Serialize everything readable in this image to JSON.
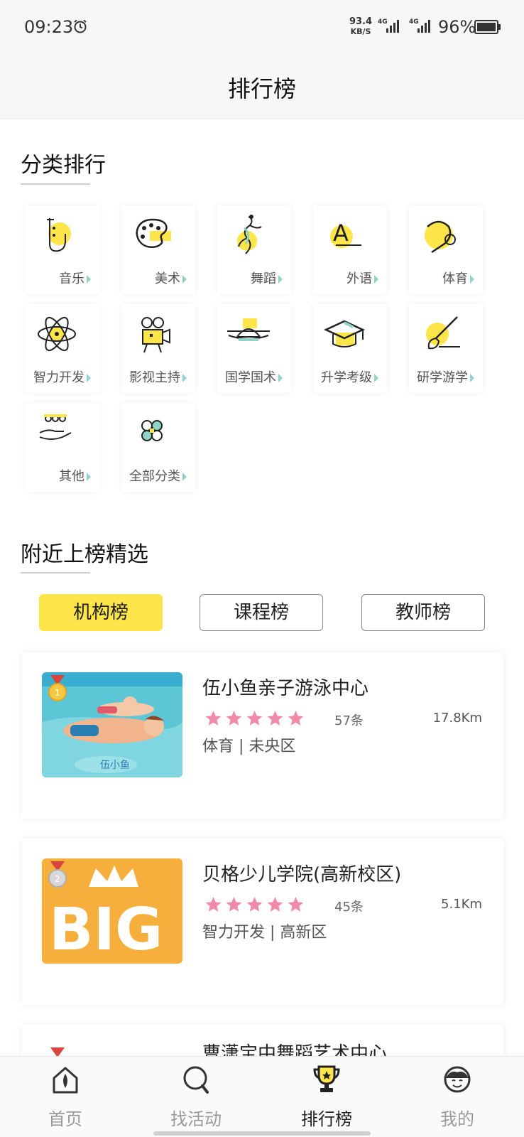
{
  "status_bar": {
    "time": "09:23",
    "net_speed": "93.4",
    "net_unit": "KB/S",
    "network_1": "4G",
    "network_2": "4G",
    "battery": "96%"
  },
  "header": {
    "title": "排行榜"
  },
  "categories_section": {
    "title": "分类排行",
    "items": [
      {
        "label": "音乐",
        "icon": "saxophone-icon"
      },
      {
        "label": "美术",
        "icon": "palette-icon"
      },
      {
        "label": "舞蹈",
        "icon": "dancer-icon"
      },
      {
        "label": "外语",
        "icon": "letter-a-icon"
      },
      {
        "label": "体育",
        "icon": "ping-pong-icon"
      },
      {
        "label": "智力开发",
        "icon": "atom-icon"
      },
      {
        "label": "影视主持",
        "icon": "film-camera-icon"
      },
      {
        "label": "国学国术",
        "icon": "traditional-hat-icon"
      },
      {
        "label": "升学考级",
        "icon": "graduation-cap-icon"
      },
      {
        "label": "研学游学",
        "icon": "paintbrush-icon"
      },
      {
        "label": "其他",
        "icon": "hand-dots-icon"
      },
      {
        "label": "全部分类",
        "icon": "clover-icon"
      }
    ]
  },
  "nearby_section": {
    "title": "附近上榜精选",
    "tabs": [
      {
        "label": "机构榜",
        "active": true
      },
      {
        "label": "课程榜",
        "active": false
      },
      {
        "label": "教师榜",
        "active": false
      }
    ],
    "list": [
      {
        "name": "伍小鱼亲子游泳中心",
        "rating": 5,
        "reviews": "57条",
        "distance": "17.8Km",
        "meta": "体育 | 未央区",
        "rank_medal": "gold",
        "thumb_text": "伍小鱼"
      },
      {
        "name": "贝格少儿学院(高新校区)",
        "rating": 5,
        "reviews": "45条",
        "distance": "5.1Km",
        "meta": "智力开发 | 高新区",
        "rank_medal": "silver",
        "thumb_text": "BIG"
      },
      {
        "name": "曹潇宝中舞蹈艺术中心",
        "rank_medal": "bronze"
      }
    ]
  },
  "bottom_nav": {
    "items": [
      {
        "label": "首页",
        "icon": "home-icon",
        "active": false
      },
      {
        "label": "找活动",
        "icon": "search-icon",
        "active": false
      },
      {
        "label": "排行榜",
        "icon": "trophy-icon",
        "active": true
      },
      {
        "label": "我的",
        "icon": "profile-icon",
        "active": false
      }
    ]
  },
  "colors": {
    "accent_yellow": "#fde54a",
    "star_pink": "#f08aa8",
    "arrow_teal": "#8fd3c9"
  }
}
